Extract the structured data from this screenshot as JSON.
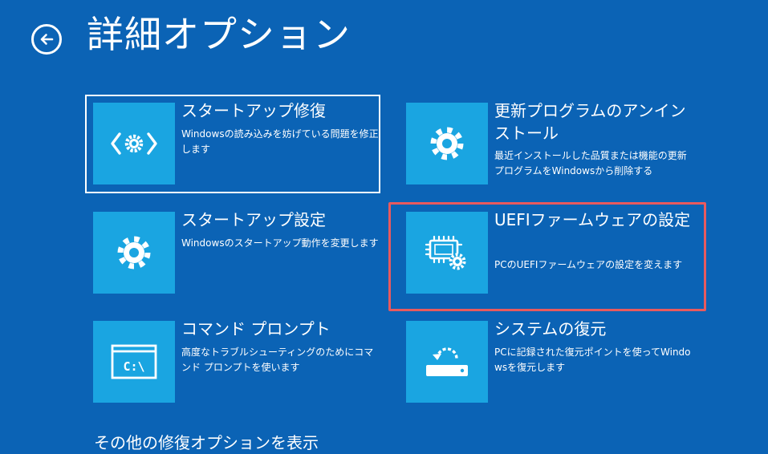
{
  "page": {
    "title": "詳細オプション",
    "more_options_label": "その他の修復オプションを表示"
  },
  "icons": {
    "back": "back-arrow-circle-icon",
    "startup_repair": "gear-code-brackets-icon",
    "uninstall_updates": "gear-icon",
    "startup_settings": "gear-icon",
    "uefi_settings": "chip-gear-icon",
    "command_prompt": "command-prompt-icon",
    "system_restore": "restore-drive-icon"
  },
  "tiles": {
    "startup_repair": {
      "title": "スタートアップ修復",
      "desc": "Windowsの読み込みを妨げている問題を修正します"
    },
    "uninstall_updates": {
      "title": "更新プログラムのアンインストール",
      "desc": "最近インストールした品質または機能の更新プログラムをWindowsから削除する"
    },
    "startup_settings": {
      "title": "スタートアップ設定",
      "desc": "Windowsのスタートアップ動作を変更します"
    },
    "uefi_settings": {
      "title": "UEFIファームウェアの設定",
      "desc": "PCのUEFIファームウェアの設定を変えます"
    },
    "command_prompt": {
      "title": "コマンド プロンプト",
      "desc": "高度なトラブルシューティングのためにコマンド プロンプトを使います"
    },
    "system_restore": {
      "title": "システムの復元",
      "desc": "PCに記録された復元ポイントを使ってWindowsを復元します"
    }
  },
  "colors": {
    "background": "#0b63b5",
    "tile_icon_bg": "#1aa5e1",
    "highlight": "#e85a5e",
    "selection": "#ffffff"
  }
}
